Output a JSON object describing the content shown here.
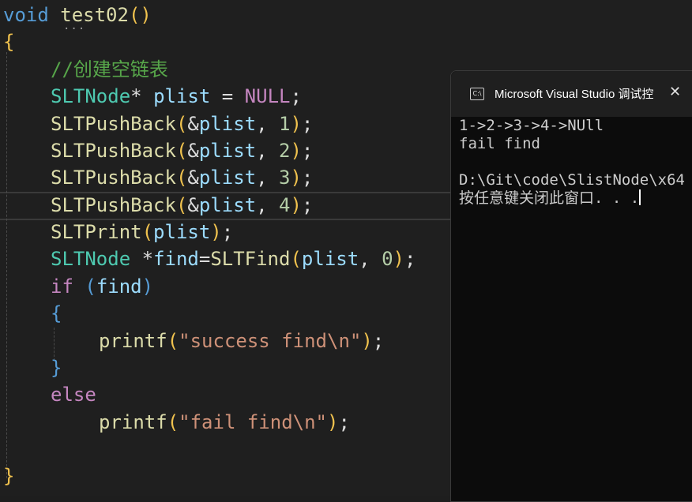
{
  "editor": {
    "lines": {
      "l0": {
        "kw": "void",
        "fn": "test02",
        "paren": "()"
      },
      "l1": {
        "brace": "{"
      },
      "l2": {
        "comment": "//创建空链表"
      },
      "l3": {
        "type": "SLTNode",
        "star": "*",
        "var": "plist",
        "op": " = ",
        "null": "NULL",
        "semi": ";"
      },
      "l4": {
        "fn": "SLTPushBack",
        "open": "(",
        "amp": "&",
        "var": "plist",
        "comma": ", ",
        "num": "1",
        "close": ")",
        "semi": ";"
      },
      "l5": {
        "fn": "SLTPushBack",
        "open": "(",
        "amp": "&",
        "var": "plist",
        "comma": ", ",
        "num": "2",
        "close": ")",
        "semi": ";"
      },
      "l6": {
        "fn": "SLTPushBack",
        "open": "(",
        "amp": "&",
        "var": "plist",
        "comma": ", ",
        "num": "3",
        "close": ")",
        "semi": ";"
      },
      "l7": {
        "fn": "SLTPushBack",
        "open": "(",
        "amp": "&",
        "var": "plist",
        "comma": ", ",
        "num": "4",
        "close": ")",
        "semi": ";"
      },
      "l8": {
        "fn": "SLTPrint",
        "open": "(",
        "var": "plist",
        "close": ")",
        "semi": ";"
      },
      "l9": {
        "type": "SLTNode",
        "star": " *",
        "var": "find",
        "eq": "=",
        "fn": "SLTFind",
        "open": "(",
        "var2": "plist",
        "comma": ", ",
        "num": "0",
        "close": ")",
        "semi": ";"
      },
      "l10": {
        "kw": "if",
        "open": " (",
        "var": "find",
        "close": ")"
      },
      "l11": {
        "brace": "{"
      },
      "l12": {
        "fn": "printf",
        "open": "(",
        "str": "\"success find\\n\"",
        "close": ")",
        "semi": ";"
      },
      "l13": {
        "brace": "}"
      },
      "l14": {
        "kw": "else"
      },
      "l15": {
        "fn": "printf",
        "open": "(",
        "str": "\"fail find\\n\"",
        "close": ")",
        "semi": ";"
      },
      "l16": {
        "brace": "}"
      }
    }
  },
  "console": {
    "title": "Microsoft Visual Studio 调试控",
    "icon_label": "C:\\",
    "close_glyph": "✕",
    "output": [
      "1->2->3->4->NUll",
      "fail find",
      "",
      "D:\\Git\\code\\SlistNode\\x64",
      "按任意键关闭此窗口. . ."
    ]
  },
  "colors": {
    "editor_bg": "#1f1f1f",
    "console_bg": "#0c0c0c",
    "keyword": "#c586c0",
    "type": "#4ec9b0",
    "function": "#dcdcaa",
    "variable": "#9cdcfe",
    "number": "#b5cea8",
    "string": "#ce9178",
    "comment": "#57a64a"
  }
}
